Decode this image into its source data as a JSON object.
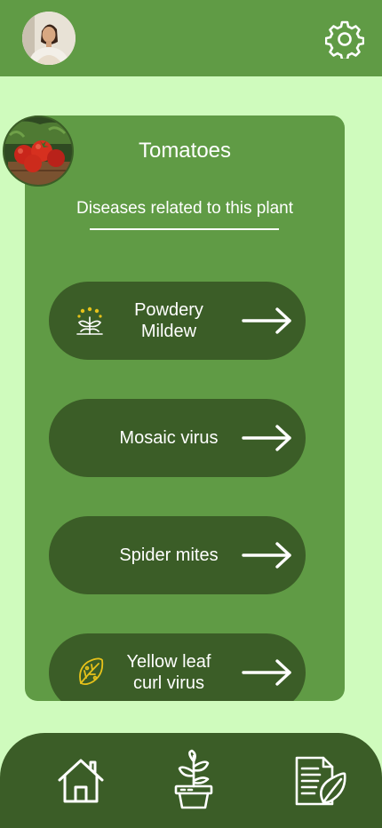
{
  "header": {
    "avatar": "user-avatar",
    "settings_icon": "gear-icon"
  },
  "plant": {
    "name": "Tomatoes",
    "thumbnail": "tomato-plant-image",
    "section_title": "Diseases related to this plant"
  },
  "diseases": [
    {
      "label": "Powdery\nMildew",
      "icon": "plant-disease-icon"
    },
    {
      "label": "Mosaic virus",
      "icon": ""
    },
    {
      "label": "Spider mites",
      "icon": ""
    },
    {
      "label": "Yellow leaf\ncurl virus",
      "icon": "leaf-icon"
    }
  ],
  "bottom_nav": {
    "items": [
      "home-icon",
      "potted-plant-icon",
      "document-leaf-icon"
    ]
  },
  "colors": {
    "background": "#cffbbd",
    "primary": "#609b45",
    "dark": "#3b5d27",
    "accent": "#e7c21a"
  }
}
